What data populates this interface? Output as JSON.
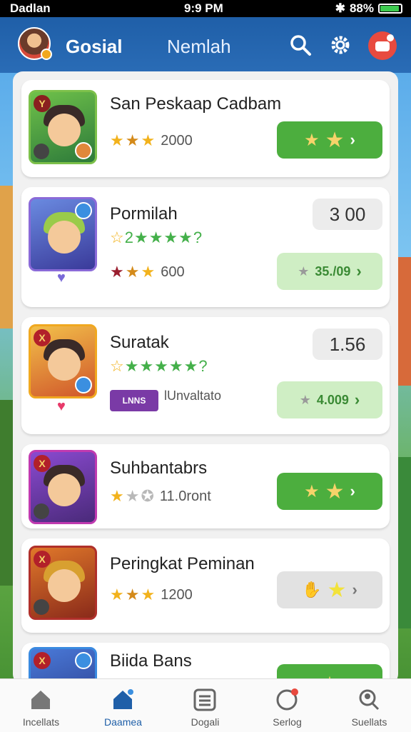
{
  "status_bar": {
    "carrier": "Dadlan",
    "time": "9:9 PM",
    "battery": "88%",
    "battery_level": 0.88
  },
  "header": {
    "title": "Gosial",
    "tab": "Nemlah",
    "icons": [
      "search-icon",
      "gear-icon",
      "notification-icon"
    ]
  },
  "cards": [
    {
      "name": "San Peskaap Cadbam",
      "rating": "2000",
      "stars_filled": 3,
      "stars_total": 3,
      "action_style": "green"
    },
    {
      "name": "Pormilah",
      "score": "3 00",
      "rating": "600",
      "stars_filled": 3,
      "stars_total": 3,
      "button_label": "35./09",
      "action_style": "light",
      "badge_stars": "2"
    },
    {
      "name": "Suratak",
      "score": "1.56",
      "tag": "LNNS",
      "subtag": "lUnvaltato",
      "button_label": "4.009",
      "action_style": "light"
    },
    {
      "name": "Suhbantabrs",
      "rating": "11.0ront",
      "stars_filled": 1,
      "stars_total": 3,
      "action_style": "green"
    },
    {
      "name": "Peringkat Peminan",
      "rating": "1200",
      "stars_filled": 3,
      "stars_total": 3,
      "action_style": "grey"
    },
    {
      "name": "Biida Bans",
      "action_style": "green"
    }
  ],
  "tabbar": {
    "items": [
      {
        "label": "Incellats",
        "icon": "home-icon",
        "active": false
      },
      {
        "label": "Daamea",
        "icon": "home-active-icon",
        "active": true
      },
      {
        "label": "Dogali",
        "icon": "list-icon",
        "active": false
      },
      {
        "label": "Serlog",
        "icon": "profile-badge-icon",
        "active": false
      },
      {
        "label": "Suellats",
        "icon": "person-search-icon",
        "active": false
      }
    ]
  },
  "colors": {
    "header": "#1f5fa8",
    "accent_green": "#4cae3e",
    "light_green": "#cfeec4",
    "star": "#f2b21c",
    "notif": "#e84a3f"
  }
}
